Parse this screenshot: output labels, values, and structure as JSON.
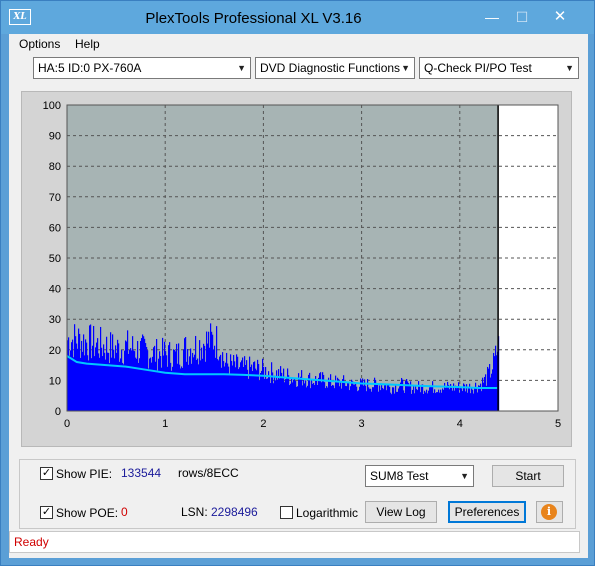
{
  "window": {
    "title": "PlexTools Professional XL V3.16",
    "app_icon_text": "XL",
    "min_glyph": "—",
    "max_glyph": "☐",
    "close_glyph": "✕"
  },
  "menu": {
    "options_label": "Options",
    "help_label": "Help"
  },
  "toolbar": {
    "drive": "HA:5 ID:0  PX-760A",
    "function": "DVD Diagnostic Functions",
    "test": "Q-Check PI/PO Test",
    "arrow_icon": "chevron-down-icon"
  },
  "chart_data": {
    "type": "bar",
    "x_ticks": [
      "0",
      "1",
      "2",
      "3",
      "4",
      "5"
    ],
    "y_ticks": [
      "0",
      "10",
      "20",
      "30",
      "40",
      "50",
      "60",
      "70",
      "80",
      "90",
      "100"
    ],
    "xlim": [
      0,
      5
    ],
    "ylim": [
      0,
      100
    ],
    "grid": true,
    "background_color": "#a7b4b4",
    "bar_color": "#0000ff",
    "line_color": "#00c8ff",
    "end_marker_x": 4.39,
    "series": [
      {
        "kind": "bars",
        "x": [
          0.0,
          0.1,
          0.2,
          0.3,
          0.4,
          0.5,
          0.6,
          0.7,
          0.8,
          0.9,
          1.0,
          1.1,
          1.2,
          1.3,
          1.4,
          1.5,
          1.55,
          1.6,
          1.7,
          1.8,
          1.9,
          2.0,
          2.1,
          2.2,
          2.3,
          2.4,
          2.5,
          2.6,
          2.7,
          2.8,
          2.9,
          3.0,
          3.1,
          3.2,
          3.3,
          3.4,
          3.5,
          3.6,
          3.7,
          3.8,
          3.9,
          4.0,
          4.1,
          4.2,
          4.25,
          4.3,
          4.35,
          4.38
        ],
        "values": [
          30,
          30,
          29,
          28,
          27,
          26,
          27,
          26,
          25,
          24,
          24,
          23,
          26,
          27,
          29,
          30,
          28,
          20,
          19,
          18,
          18,
          17,
          16,
          15,
          14,
          14,
          13,
          13,
          12,
          12,
          11,
          11,
          11,
          11,
          10,
          11,
          10,
          10,
          10,
          10,
          10,
          10,
          10,
          11,
          13,
          16,
          21,
          27
        ]
      },
      {
        "kind": "line",
        "x": [
          0.0,
          0.05,
          0.1,
          0.2,
          0.4,
          0.6,
          0.8,
          1.0,
          1.2,
          1.4,
          1.6,
          1.8,
          2.0,
          2.2,
          2.4,
          2.6,
          2.8,
          3.0,
          3.2,
          3.4,
          3.6,
          3.8,
          4.0,
          4.2,
          4.38
        ],
        "values": [
          18,
          17,
          16,
          15.5,
          15,
          14.5,
          13.5,
          12.5,
          12,
          12,
          12,
          11.8,
          11.5,
          11,
          10.5,
          10,
          9.5,
          9,
          8.8,
          8.5,
          8.2,
          8,
          7.8,
          7.5,
          7.5
        ]
      }
    ]
  },
  "stats": {
    "show_pie_label": "Show PIE:",
    "show_pie_checked": "✓",
    "pie_value": "133544",
    "pie_unit": "rows/8ECC",
    "show_poe_label": "Show POE:",
    "show_poe_checked": "✓",
    "poe_value": "0",
    "lsn_label": "LSN:",
    "lsn_value": "2298496",
    "logarithmic_label": "Logarithmic"
  },
  "controls": {
    "sum_test": "SUM8 Test",
    "start_label": "Start",
    "view_log_label": "View Log",
    "preferences_label": "Preferences",
    "info_icon_text": "i"
  },
  "status": {
    "text": "Ready"
  }
}
